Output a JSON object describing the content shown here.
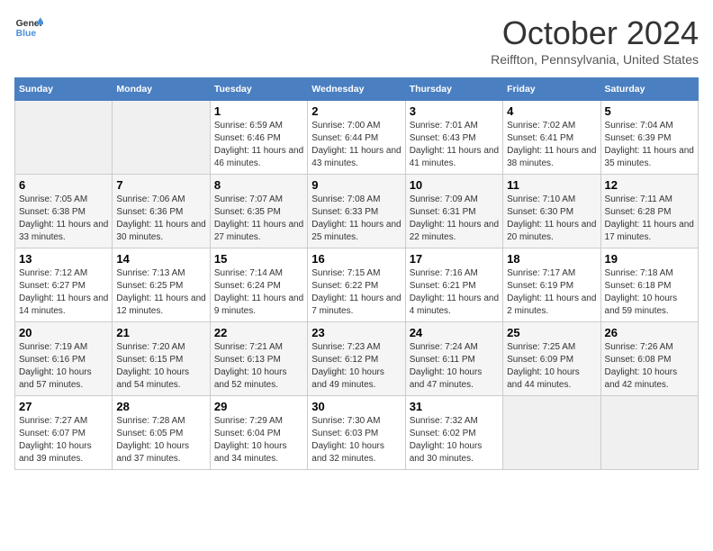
{
  "header": {
    "logo_line1": "General",
    "logo_line2": "Blue",
    "month_title": "October 2024",
    "location": "Reiffton, Pennsylvania, United States"
  },
  "columns": [
    "Sunday",
    "Monday",
    "Tuesday",
    "Wednesday",
    "Thursday",
    "Friday",
    "Saturday"
  ],
  "weeks": [
    [
      {
        "empty": true
      },
      {
        "empty": true
      },
      {
        "day": 1,
        "sunrise": "6:59 AM",
        "sunset": "6:46 PM",
        "daylight": "11 hours and 46 minutes."
      },
      {
        "day": 2,
        "sunrise": "7:00 AM",
        "sunset": "6:44 PM",
        "daylight": "11 hours and 43 minutes."
      },
      {
        "day": 3,
        "sunrise": "7:01 AM",
        "sunset": "6:43 PM",
        "daylight": "11 hours and 41 minutes."
      },
      {
        "day": 4,
        "sunrise": "7:02 AM",
        "sunset": "6:41 PM",
        "daylight": "11 hours and 38 minutes."
      },
      {
        "day": 5,
        "sunrise": "7:04 AM",
        "sunset": "6:39 PM",
        "daylight": "11 hours and 35 minutes."
      }
    ],
    [
      {
        "day": 6,
        "sunrise": "7:05 AM",
        "sunset": "6:38 PM",
        "daylight": "11 hours and 33 minutes."
      },
      {
        "day": 7,
        "sunrise": "7:06 AM",
        "sunset": "6:36 PM",
        "daylight": "11 hours and 30 minutes."
      },
      {
        "day": 8,
        "sunrise": "7:07 AM",
        "sunset": "6:35 PM",
        "daylight": "11 hours and 27 minutes."
      },
      {
        "day": 9,
        "sunrise": "7:08 AM",
        "sunset": "6:33 PM",
        "daylight": "11 hours and 25 minutes."
      },
      {
        "day": 10,
        "sunrise": "7:09 AM",
        "sunset": "6:31 PM",
        "daylight": "11 hours and 22 minutes."
      },
      {
        "day": 11,
        "sunrise": "7:10 AM",
        "sunset": "6:30 PM",
        "daylight": "11 hours and 20 minutes."
      },
      {
        "day": 12,
        "sunrise": "7:11 AM",
        "sunset": "6:28 PM",
        "daylight": "11 hours and 17 minutes."
      }
    ],
    [
      {
        "day": 13,
        "sunrise": "7:12 AM",
        "sunset": "6:27 PM",
        "daylight": "11 hours and 14 minutes."
      },
      {
        "day": 14,
        "sunrise": "7:13 AM",
        "sunset": "6:25 PM",
        "daylight": "11 hours and 12 minutes."
      },
      {
        "day": 15,
        "sunrise": "7:14 AM",
        "sunset": "6:24 PM",
        "daylight": "11 hours and 9 minutes."
      },
      {
        "day": 16,
        "sunrise": "7:15 AM",
        "sunset": "6:22 PM",
        "daylight": "11 hours and 7 minutes."
      },
      {
        "day": 17,
        "sunrise": "7:16 AM",
        "sunset": "6:21 PM",
        "daylight": "11 hours and 4 minutes."
      },
      {
        "day": 18,
        "sunrise": "7:17 AM",
        "sunset": "6:19 PM",
        "daylight": "11 hours and 2 minutes."
      },
      {
        "day": 19,
        "sunrise": "7:18 AM",
        "sunset": "6:18 PM",
        "daylight": "10 hours and 59 minutes."
      }
    ],
    [
      {
        "day": 20,
        "sunrise": "7:19 AM",
        "sunset": "6:16 PM",
        "daylight": "10 hours and 57 minutes."
      },
      {
        "day": 21,
        "sunrise": "7:20 AM",
        "sunset": "6:15 PM",
        "daylight": "10 hours and 54 minutes."
      },
      {
        "day": 22,
        "sunrise": "7:21 AM",
        "sunset": "6:13 PM",
        "daylight": "10 hours and 52 minutes."
      },
      {
        "day": 23,
        "sunrise": "7:23 AM",
        "sunset": "6:12 PM",
        "daylight": "10 hours and 49 minutes."
      },
      {
        "day": 24,
        "sunrise": "7:24 AM",
        "sunset": "6:11 PM",
        "daylight": "10 hours and 47 minutes."
      },
      {
        "day": 25,
        "sunrise": "7:25 AM",
        "sunset": "6:09 PM",
        "daylight": "10 hours and 44 minutes."
      },
      {
        "day": 26,
        "sunrise": "7:26 AM",
        "sunset": "6:08 PM",
        "daylight": "10 hours and 42 minutes."
      }
    ],
    [
      {
        "day": 27,
        "sunrise": "7:27 AM",
        "sunset": "6:07 PM",
        "daylight": "10 hours and 39 minutes."
      },
      {
        "day": 28,
        "sunrise": "7:28 AM",
        "sunset": "6:05 PM",
        "daylight": "10 hours and 37 minutes."
      },
      {
        "day": 29,
        "sunrise": "7:29 AM",
        "sunset": "6:04 PM",
        "daylight": "10 hours and 34 minutes."
      },
      {
        "day": 30,
        "sunrise": "7:30 AM",
        "sunset": "6:03 PM",
        "daylight": "10 hours and 32 minutes."
      },
      {
        "day": 31,
        "sunrise": "7:32 AM",
        "sunset": "6:02 PM",
        "daylight": "10 hours and 30 minutes."
      },
      {
        "empty": true
      },
      {
        "empty": true
      }
    ]
  ],
  "labels": {
    "sunrise": "Sunrise:",
    "sunset": "Sunset:",
    "daylight": "Daylight:"
  }
}
